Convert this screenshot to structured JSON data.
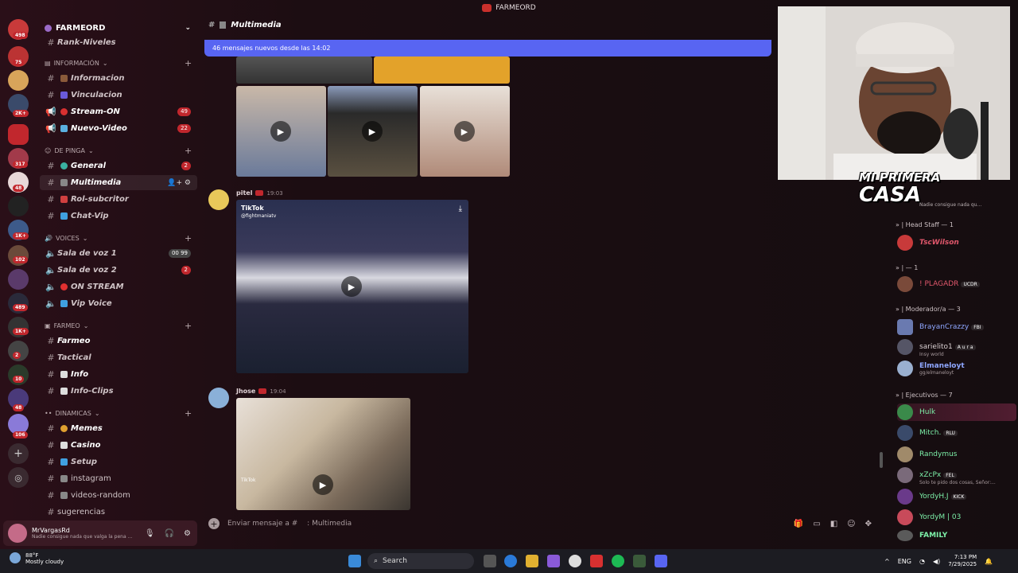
{
  "window": {
    "title": "FARMEORD"
  },
  "server_rail": {
    "badges": [
      "498",
      "75",
      "2K+",
      "317",
      "48",
      "1K+",
      "102",
      "489",
      "1K+",
      "2",
      "10",
      "48",
      "106"
    ]
  },
  "server": {
    "name": "FARMEORD"
  },
  "sidebar": {
    "top_channel": "Rank-Niveles",
    "categories": [
      {
        "label": "INFORMACIÓN",
        "channels": [
          {
            "name": "Informacion",
            "badge": ""
          },
          {
            "name": "Vinculacion",
            "badge": ""
          },
          {
            "name": "Stream-ON",
            "badge": "49"
          },
          {
            "name": "Nuevo-Video",
            "badge": "22"
          }
        ]
      },
      {
        "label": "DE PINGA",
        "channels": [
          {
            "name": "General",
            "badge": "2"
          },
          {
            "name": "Multimedia",
            "badge": ""
          },
          {
            "name": "Rol-subcritor",
            "badge": ""
          },
          {
            "name": "Chat-Vip",
            "badge": ""
          }
        ]
      },
      {
        "label": "VOICES",
        "channels": [
          {
            "name": "Sala de voz 1",
            "badge": "00 99"
          },
          {
            "name": "Sala de voz 2",
            "badge": "2"
          },
          {
            "name": "ON STREAM",
            "badge": ""
          },
          {
            "name": "Vip Voice",
            "badge": ""
          }
        ]
      },
      {
        "label": "FARMEO",
        "channels": [
          {
            "name": "Farmeo",
            "badge": ""
          },
          {
            "name": "Tactical",
            "badge": ""
          },
          {
            "name": "Info",
            "badge": ""
          },
          {
            "name": "Info-Clips",
            "badge": ""
          }
        ]
      },
      {
        "label": "DINAMICAS",
        "channels": [
          {
            "name": "Memes",
            "badge": ""
          },
          {
            "name": "Casino",
            "badge": ""
          },
          {
            "name": "Setup",
            "badge": ""
          },
          {
            "name": "instagram",
            "badge": ""
          },
          {
            "name": "videos-random",
            "badge": ""
          },
          {
            "name": "sugerencias",
            "badge": ""
          }
        ]
      }
    ]
  },
  "user_panel": {
    "username": "MrVargasRd",
    "status": "Nadie consigue nada que valga la pena ..."
  },
  "chat": {
    "channel_name": "Multimedia",
    "new_messages_bar": "46 mensajes nuevos desde las 14:02",
    "messages": [
      {
        "author": "pitel",
        "time": "19:03",
        "video_overlay": "TikTok",
        "video_handle": "@fightmaniatv"
      },
      {
        "author": "Jhose",
        "time": "19:04",
        "video_overlay": "TikTok"
      }
    ],
    "composer_placeholder": "Enviar mensaje a #  : Multimedia"
  },
  "stream_overlay": {
    "title_line1": "MI PRIMERA",
    "title_line2": "CASA",
    "status_text": "Nadie consigue nada qu..."
  },
  "members": {
    "groups": [
      {
        "label": "» | Head Staff — 1",
        "members": [
          {
            "name": "TscWilson",
            "tag": "",
            "sub": "",
            "color": "#e0576b"
          }
        ]
      },
      {
        "label": "» | — 1",
        "members": [
          {
            "name": "! PLAGADR",
            "tag": "UCDR",
            "sub": "",
            "color": "#e0576b"
          }
        ]
      },
      {
        "label": "» | Moderador/a — 3",
        "members": [
          {
            "name": "BrayanCrazzy",
            "tag": "FBI",
            "sub": "",
            "color": "#8fa7ff"
          },
          {
            "name": "sarielito1",
            "tag": "A u r a",
            "sub": "Insy world",
            "color": "#dcd2d4"
          },
          {
            "name": "Elmaneloyt",
            "tag": "",
            "sub": "gg/elmaneloyt",
            "color": "#8fa7ff"
          }
        ]
      },
      {
        "label": "» | Ejecutivos — 7",
        "members": [
          {
            "name": "Hulk",
            "tag": "",
            "sub": "",
            "color": "#7df0a8"
          },
          {
            "name": "Mitch.",
            "tag": "RLU",
            "sub": "",
            "color": "#7df0a8"
          },
          {
            "name": "Randymus",
            "tag": "",
            "sub": "",
            "color": "#7df0a8"
          },
          {
            "name": "xZcPx",
            "tag": "FEL",
            "sub": "Solo te pido dos cosas, Señor:...",
            "color": "#7df0a8"
          },
          {
            "name": "YordyH.J",
            "tag": "KICK",
            "sub": "",
            "color": "#7df0a8"
          },
          {
            "name": "YordyM | 03",
            "tag": "",
            "sub": "",
            "color": "#7df0a8"
          },
          {
            "name": "FAMILY",
            "tag": "",
            "sub": "",
            "color": "#7df0a8"
          }
        ]
      }
    ]
  },
  "taskbar": {
    "weather_temp": "88°F",
    "weather_desc": "Mostly cloudy",
    "search_label": "Search",
    "language": "ENG",
    "time": "7:13 PM",
    "date": "7/29/2025"
  },
  "colors": {
    "accent": "#5865f2",
    "badge": "#c1272d",
    "bg": "#1c0d12"
  }
}
